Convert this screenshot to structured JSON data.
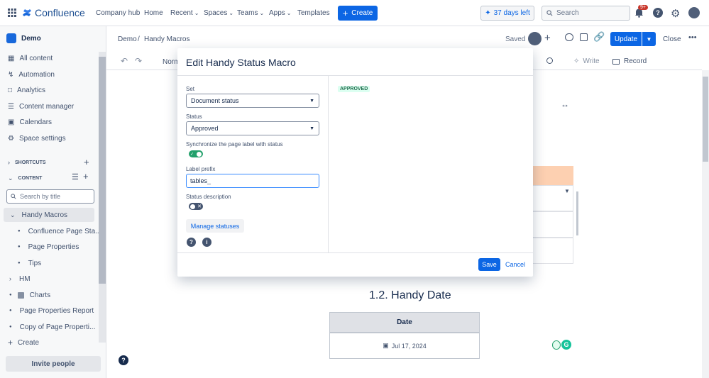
{
  "topnav": {
    "product": "Confluence",
    "items": [
      "Company hub",
      "Home",
      "Recent",
      "Spaces",
      "Teams",
      "Apps",
      "Templates"
    ],
    "create_label": "Create",
    "trial_label": "37 days left",
    "search_placeholder": "Search",
    "notif_count": "9+"
  },
  "sidebar": {
    "space_name": "Demo",
    "items": [
      "All content",
      "Automation",
      "Analytics",
      "Content manager",
      "Calendars",
      "Space settings"
    ],
    "shortcuts_label": "SHORTCUTS",
    "content_label": "CONTENT",
    "search_placeholder": "Search by title",
    "tree": [
      "Handy Macros",
      "Confluence Page Sta...",
      "Page Properties",
      "Tips",
      "HM",
      "Charts",
      "Page Properties Report",
      "Copy of Page Properti...",
      "Create"
    ],
    "invite_label": "Invite people"
  },
  "page": {
    "breadcrumb_space": "Demo",
    "breadcrumb_page": "Handy Macros",
    "saved_label": "Saved",
    "update_label": "Update",
    "close_label": "Close",
    "toolbar_style": "Norm",
    "write_label": "Write",
    "record_label": "Record",
    "section_heading": "1.2. Handy Date",
    "date_header": "Date",
    "date_value": "Jul 17, 2024"
  },
  "modal": {
    "title": "Edit Handy Status Macro",
    "set_label": "Set",
    "set_value": "Document status",
    "status_label": "Status",
    "status_value": "Approved",
    "sync_label": "Synchronize the page label with status",
    "sync_on": true,
    "prefix_label": "Label prefix",
    "prefix_value": "tables_",
    "desc_label": "Status description",
    "desc_on": false,
    "manage_label": "Manage statuses",
    "preview_badge": "APPROVED",
    "save_label": "Save",
    "cancel_label": "Cancel"
  },
  "colors": {
    "brand": "#0c66e4",
    "overlay": "#091e42",
    "badge_bg": "#dcfff1",
    "badge_text": "#216e4e",
    "toggle_on": "#22a06b",
    "toggle_off": "#44546f"
  }
}
